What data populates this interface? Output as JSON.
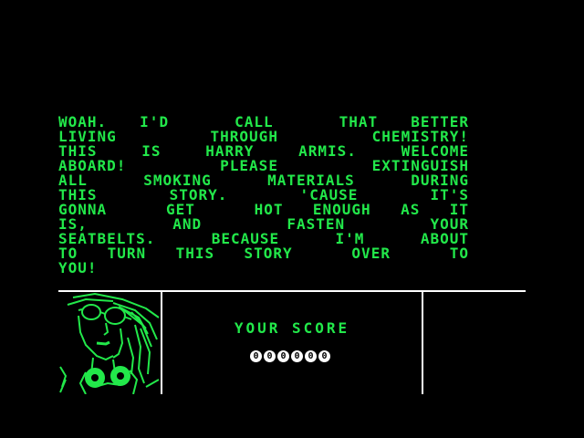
{
  "narration": {
    "lines": [
      "WOAH. I'D  CALL  THAT BETTER",
      "LIVING  THROUGH  CHEMISTRY!",
      "THIS IS HARRY ARMIS. WELCOME",
      "ABOARD!  PLEASE  EXTINGUISH",
      "ALL SMOKING MATERIALS DURING",
      "THIS  STORY.  'CAUSE  IT'S",
      "GONNA  GET  HOT ENOUGH AS IT",
      "IS,  AND  FASTEN  YOUR",
      "SEATBELTS. BECAUSE I'M ABOUT",
      "TO TURN THIS STORY  OVER  TO",
      "YOU!"
    ]
  },
  "hud": {
    "score_label": "YOUR SCORE",
    "score_digits": [
      "0",
      "0",
      "0",
      "0",
      "0",
      "0"
    ]
  },
  "colors": {
    "text": "#22e84a",
    "frame": "#ffffff",
    "background": "#000000"
  },
  "icons": {
    "portrait": "harry-armis-portrait"
  }
}
